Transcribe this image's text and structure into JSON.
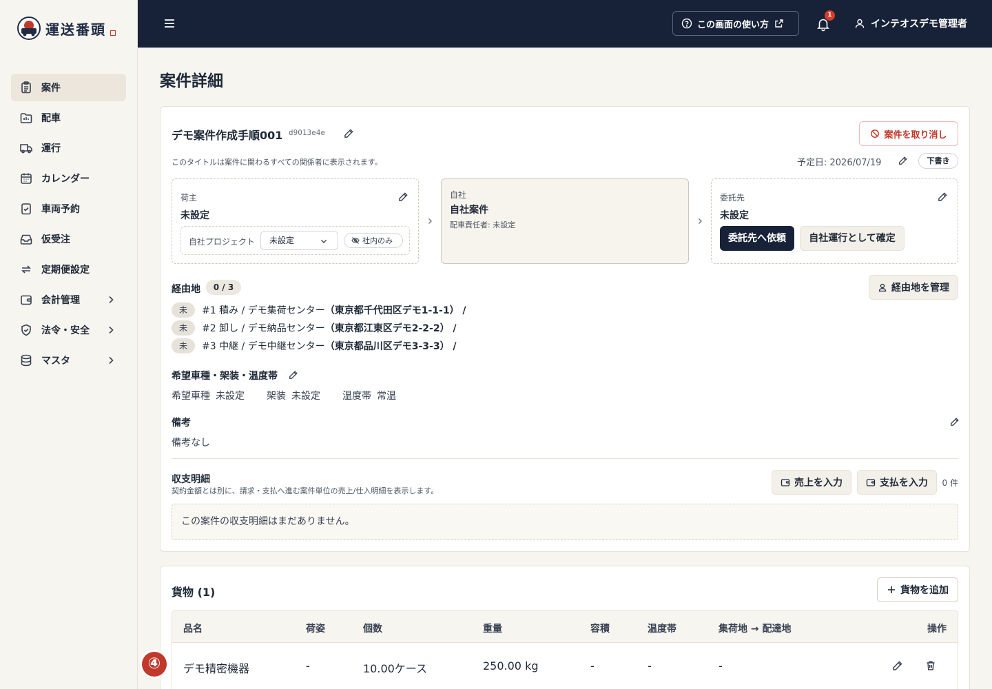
{
  "app": {
    "name": "運送番頭"
  },
  "sidebar": {
    "items": [
      {
        "label": "案件",
        "icon": "clipboard-icon"
      },
      {
        "label": "配車",
        "icon": "folder-icon"
      },
      {
        "label": "運行",
        "icon": "truck-icon"
      },
      {
        "label": "カレンダー",
        "icon": "calendar-icon"
      },
      {
        "label": "車両予約",
        "icon": "clipboard-check-icon"
      },
      {
        "label": "仮受注",
        "icon": "inbox-icon"
      },
      {
        "label": "定期便設定",
        "icon": "repeat-icon"
      },
      {
        "label": "会計管理",
        "icon": "wallet-icon"
      },
      {
        "label": "法令・安全",
        "icon": "shield-check-icon"
      },
      {
        "label": "マスタ",
        "icon": "database-icon"
      }
    ]
  },
  "header": {
    "help_label": "この画面の使い方",
    "notification_count": "1",
    "user_name": "インテオスデモ管理者"
  },
  "page": {
    "title": "案件詳細"
  },
  "case": {
    "title": "デモ案件作成手順001",
    "id": "d9013e4e",
    "title_note": "このタイトルは案件に関わるすべての関係者に表示されます。",
    "cancel_label": "案件を取り消し",
    "schedule": "予定日: 2026/07/19",
    "status": "下書き"
  },
  "shipper": {
    "label": "荷主",
    "value": "未設定",
    "project_label": "自社プロジェクト",
    "project_value": "未設定",
    "internal_label": "社内のみ"
  },
  "own": {
    "label": "自社",
    "value": "自社案件",
    "sub": "配車責任者: 未設定"
  },
  "contractor": {
    "label": "委託先",
    "value": "未設定",
    "request_label": "委託先へ依頼",
    "self_label": "自社運行として確定"
  },
  "via": {
    "title": "経由地",
    "count": "0 / 3",
    "manage_label": "経由地を管理",
    "stops": [
      {
        "badge": "未",
        "text": "#1 積み / デモ集荷センター",
        "addr": "（東京都千代田区デモ1-1-1） /"
      },
      {
        "badge": "未",
        "text": "#2 卸し / デモ納品センター",
        "addr": "（東京都江東区デモ2-2-2） /"
      },
      {
        "badge": "未",
        "text": "#3 中継 / デモ中継センター",
        "addr": "（東京都品川区デモ3-3-3） /"
      }
    ]
  },
  "vehicle": {
    "title": "希望車種・架装・温度帯",
    "type_key": "希望車種",
    "type_val": "未設定",
    "body_key": "架装",
    "body_val": "未設定",
    "temp_key": "温度帯",
    "temp_val": "常温"
  },
  "notes": {
    "title": "備考",
    "text": "備考なし"
  },
  "finance": {
    "title": "収支明細",
    "sub": "契約金額とは別に、請求・支払へ進む案件単位の売上/仕入明細を表示します。",
    "sales_label": "売上を入力",
    "pay_label": "支払を入力",
    "count": "0 件",
    "empty": "この案件の収支明細はまだありません。"
  },
  "cargo": {
    "title": "貨物 (1)",
    "add_label": "貨物を追加",
    "columns": [
      "品名",
      "荷姿",
      "個数",
      "重量",
      "容積",
      "温度帯",
      "集荷地 → 配達地",
      "操作"
    ],
    "rows": [
      {
        "name": "デモ精密機器",
        "pack": "-",
        "qty": "10.00ケース",
        "weight": "250.00 kg",
        "volume": "-",
        "temp": "-",
        "route": "-"
      }
    ]
  },
  "marker": "④"
}
